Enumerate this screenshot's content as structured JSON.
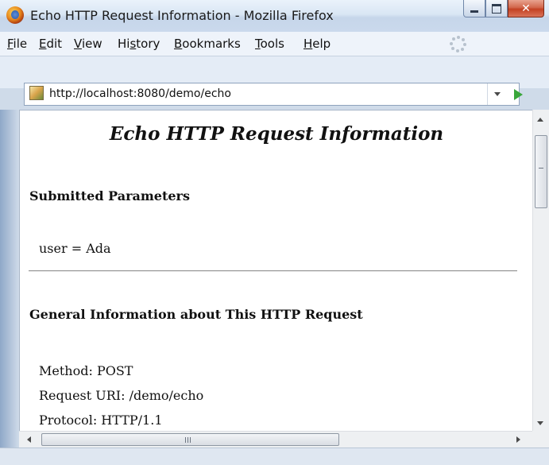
{
  "window": {
    "title": "Echo HTTP Request Information - Mozilla Firefox",
    "icon": "firefox-icon",
    "controls": {
      "minimize": "minimize-icon",
      "maximize": "maximize-icon",
      "close": "close-icon"
    }
  },
  "menubar": {
    "items": [
      {
        "label": "File",
        "accesskey": "F"
      },
      {
        "label": "Edit",
        "accesskey": "E"
      },
      {
        "label": "View",
        "accesskey": "V"
      },
      {
        "label": "History",
        "accesskey": "s"
      },
      {
        "label": "Bookmarks",
        "accesskey": "B"
      },
      {
        "label": "Tools",
        "accesskey": "T"
      },
      {
        "label": "Help",
        "accesskey": "H"
      }
    ]
  },
  "address_bar": {
    "url": "http://localhost:8080/demo/echo",
    "site_icon": "page-favicon-icon",
    "dropdown_icon": "dropdown-arrow-icon",
    "go_icon": "go-arrow-icon"
  },
  "page": {
    "title": "Echo HTTP Request Information",
    "sections": {
      "submitted": {
        "heading": "Submitted Parameters",
        "params": [
          "user = Ada"
        ]
      },
      "general": {
        "heading": "General Information about This HTTP Request",
        "lines": [
          "Method: POST",
          "Request URI: /demo/echo",
          "Protocol: HTTP/1.1"
        ]
      }
    }
  },
  "colors": {
    "frame": "#cfdbe9",
    "go_arrow": "#39a63a",
    "close_button": "#c44122"
  }
}
